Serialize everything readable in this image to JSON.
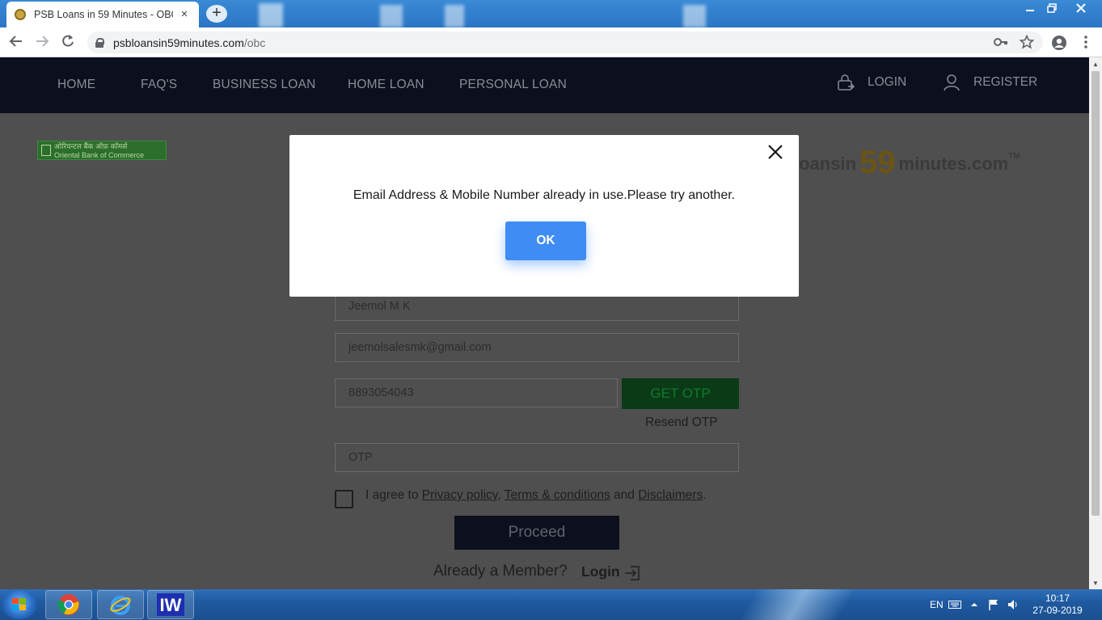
{
  "browser": {
    "tab_title": "PSB Loans in 59 Minutes - OBC -",
    "tab_close": "×",
    "new_tab": "+",
    "url_domain": "psbloansin59minutes.com",
    "url_path": "/obc",
    "window_controls": {
      "minimize": "–",
      "maximize": "❐",
      "close": "✕"
    }
  },
  "site_nav": {
    "links": [
      "HOME",
      "FAQ'S",
      "BUSINESS LOAN",
      "HOME LOAN",
      "PERSONAL LOAN"
    ],
    "login": "LOGIN",
    "register": "REGISTER"
  },
  "bank_logo": {
    "line1": "ओरियन्टल बैंक ऑफ़ कॉमर्स",
    "line2": "Oriental Bank of Commerce"
  },
  "brand": {
    "prefix": "loansin",
    "number": "59",
    "suffix": "minutes.com",
    "tm": "TM"
  },
  "form": {
    "name_value": "Jeemol M K",
    "email_value": "jeemolsalesmk@gmail.com",
    "mobile_value": "8893054043",
    "get_otp_label": "GET OTP",
    "resend_otp_label": "Resend OTP",
    "otp_placeholder": "OTP",
    "agree_prefix": "I agree to ",
    "privacy_link": "Privacy policy",
    "comma": ",",
    "terms_link": "Terms & conditions",
    "and_text": " and ",
    "disclaimers_link": "Disclaimers",
    "period": ".",
    "proceed_label": "Proceed",
    "member_text": "Already a Member?",
    "login_label": "Login"
  },
  "modal": {
    "message": "Email Address & Mobile Number already in use.Please try another.",
    "ok_label": "OK"
  },
  "taskbar": {
    "language": "EN",
    "time": "10:17",
    "date": "27-09-2019",
    "apps": [
      "chrome-icon",
      "internet-explorer-icon",
      "iw-app-icon"
    ],
    "iw_label": "IW"
  },
  "colors": {
    "nav_bg": "#0b0f1e",
    "ok_button": "#3f8cf4",
    "get_otp_bg": "#0a3b16"
  }
}
